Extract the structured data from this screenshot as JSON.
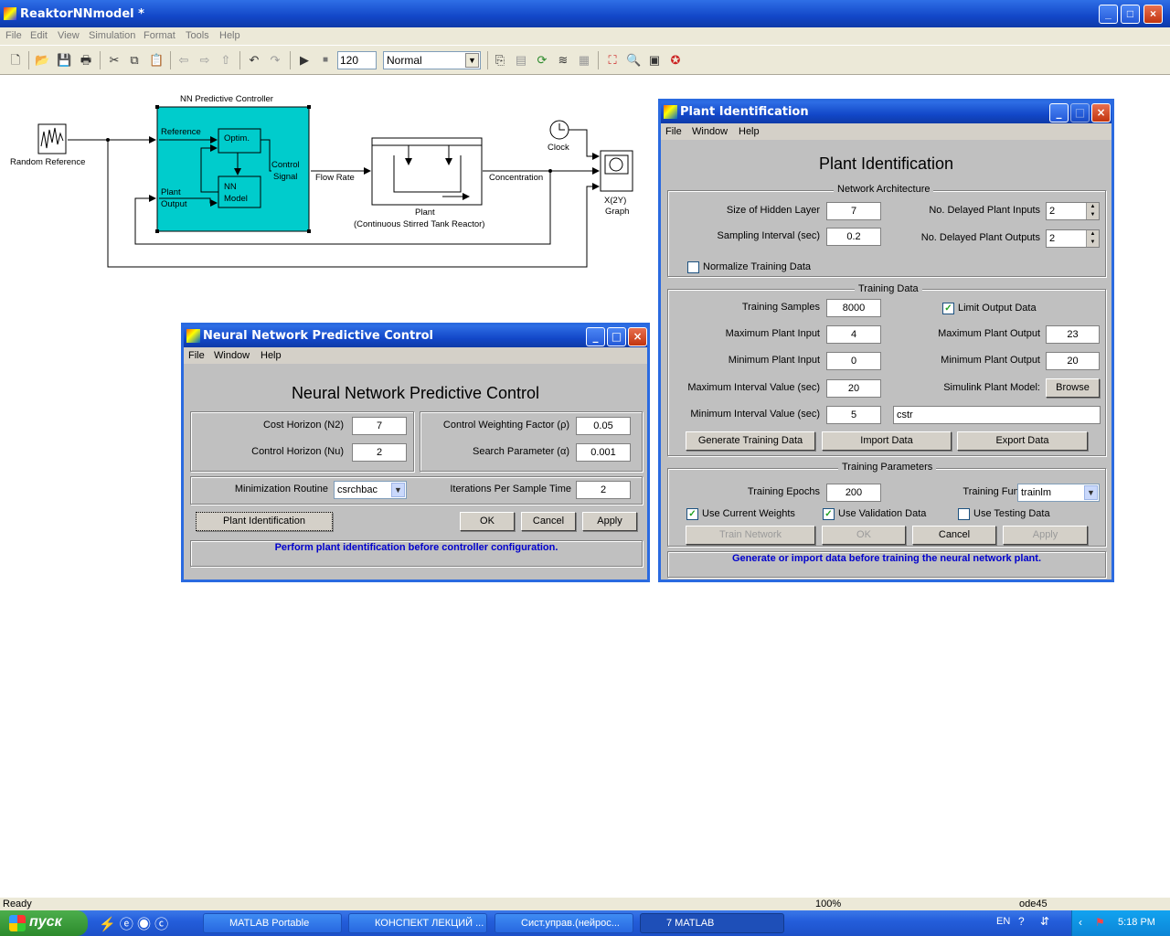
{
  "window": {
    "title": "ReaktorNNmodel *",
    "caption_buttons": {
      "minimize": "_",
      "maximize": "□",
      "close": "×"
    }
  },
  "menu": [
    "File",
    "Edit",
    "View",
    "Simulation",
    "Format",
    "Tools",
    "Help"
  ],
  "toolbar": {
    "stop_time": "120",
    "sim_mode": "Normal"
  },
  "diagram": {
    "random_reference": "Random Reference",
    "controller_title": "NN Predictive Controller",
    "reference_port": "Reference",
    "optim": "Optim.",
    "nn_model_1": "NN",
    "nn_model_2": "Model",
    "plant_output_1": "Plant",
    "plant_output_2": "Output",
    "control_1": "Control",
    "control_2": "Signal",
    "flow_rate": "Flow Rate",
    "plant_1": "Plant",
    "plant_2": "(Continuous Stirred Tank Reactor)",
    "concentration": "Concentration",
    "clock": "Clock",
    "xy_1": "X(2Y)",
    "xy_2": "Graph"
  },
  "status": {
    "ready": "Ready",
    "zoom": "100%",
    "solver": "ode45"
  },
  "taskbar": {
    "start": "пуск",
    "tasks": [
      "MATLAB Portable",
      "КОНСПЕКТ ЛЕКЦИЙ ...",
      "Сист.управ.(нейрос...",
      "7 MATLAB"
    ],
    "lang": "EN",
    "clock": "5:18 PM"
  },
  "nnpc": {
    "caption": "Neural Network Predictive Control",
    "menu": [
      "File",
      "Window",
      "Help"
    ],
    "heading": "Neural Network Predictive Control",
    "cost_horizon_label": "Cost Horizon (N2)",
    "cost_horizon": "7",
    "control_horizon_label": "Control Horizon (Nu)",
    "control_horizon": "2",
    "weighting_label": "Control Weighting Factor (ρ)",
    "weighting": "0.05",
    "search_label": "Search Parameter (α)",
    "search": "0.001",
    "minimization_label": "Minimization Routine",
    "minimization": "csrchbac",
    "iterations_label": "Iterations Per Sample Time",
    "iterations": "2",
    "plant_id_btn": "Plant Identification",
    "ok_btn": "OK",
    "cancel_btn": "Cancel",
    "apply_btn": "Apply",
    "message": "Perform plant identification before controller configuration."
  },
  "pid": {
    "caption": "Plant Identification",
    "menu": [
      "File",
      "Window",
      "Help"
    ],
    "heading": "Plant Identification",
    "arch_group": "Network Architecture",
    "hidden_label": "Size of Hidden Layer",
    "hidden": "7",
    "sampling_label": "Sampling Interval (sec)",
    "sampling": "0.2",
    "delayed_inputs_label": "No. Delayed Plant Inputs",
    "delayed_inputs": "2",
    "delayed_outputs_label": "No. Delayed Plant Outputs",
    "delayed_outputs": "2",
    "normalize_label": "Normalize Training Data",
    "training_group": "Training Data",
    "samples_label": "Training Samples",
    "samples": "8000",
    "limit_label": "Limit Output Data",
    "max_input_label": "Maximum Plant Input",
    "max_input": "4",
    "min_input_label": "Minimum Plant Input",
    "min_input": "0",
    "max_interval_label": "Maximum Interval Value (sec)",
    "max_interval": "20",
    "min_interval_label": "Minimum Interval Value (sec)",
    "min_interval": "5",
    "max_output_label": "Maximum Plant Output",
    "max_output": "23",
    "min_output_label": "Minimum Plant Output",
    "min_output": "20",
    "sim_model_label": "Simulink Plant Model:",
    "browse_btn": "Browse",
    "model_name": "cstr",
    "generate_btn": "Generate Training Data",
    "import_btn": "Import Data",
    "export_btn": "Export Data",
    "params_group": "Training Parameters",
    "epochs_label": "Training Epochs",
    "epochs": "200",
    "function_label": "Training Function",
    "function": "trainlm",
    "current_weights_label": "Use Current Weights",
    "validation_label": "Use Validation Data",
    "testing_label": "Use Testing Data",
    "train_btn": "Train Network",
    "ok_btn": "OK",
    "cancel_btn": "Cancel",
    "apply_btn": "Apply",
    "message": "Generate or import data before training the neural network plant."
  },
  "check_mark": "✓",
  "dropdown_arrow": "▼"
}
